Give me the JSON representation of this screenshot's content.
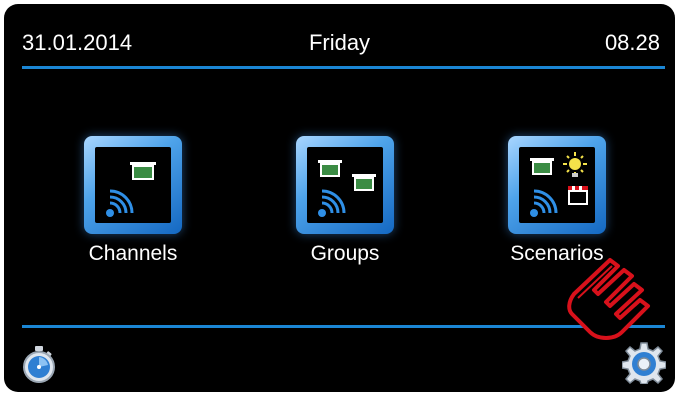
{
  "header": {
    "date": "31.01.2014",
    "day": "Friday",
    "time": "08.28"
  },
  "menu": {
    "channels_label": "Channels",
    "groups_label": "Groups",
    "scenarios_label": "Scenarios"
  },
  "icons": {
    "timer": "stopwatch-icon",
    "settings": "gear-icon",
    "pointer": "hand-pointer-icon"
  },
  "colors": {
    "accent": "#1b86d4",
    "tile_blue": "#4ea3ea",
    "pointer_red": "#d8111b"
  }
}
